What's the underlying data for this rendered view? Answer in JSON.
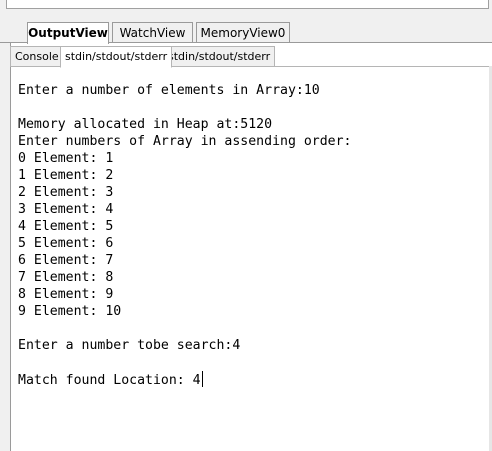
{
  "view_tabs": [
    {
      "label": "OutputView",
      "active": true
    },
    {
      "label": "WatchView",
      "active": false
    },
    {
      "label": "MemoryView0",
      "active": false
    }
  ],
  "output_tabs": [
    {
      "label": "Console",
      "active": false
    },
    {
      "label": "stdin/stdout/stderr",
      "active": true
    },
    {
      "label": "stdin/stdout/stderr",
      "active": false
    }
  ],
  "console": {
    "lines": [
      "Enter a number of elements in Array:10",
      "",
      "Memory allocated in Heap at:5120",
      "Enter numbers of Array in assending order:",
      "0 Element: 1",
      "1 Element: 2",
      "2 Element: 3",
      "3 Element: 4",
      "4 Element: 5",
      "5 Element: 6",
      "6 Element: 7",
      "7 Element: 8",
      "8 Element: 9",
      "9 Element: 10",
      "",
      "Enter a number tobe search:4",
      "",
      "Match found Location: 4"
    ]
  }
}
